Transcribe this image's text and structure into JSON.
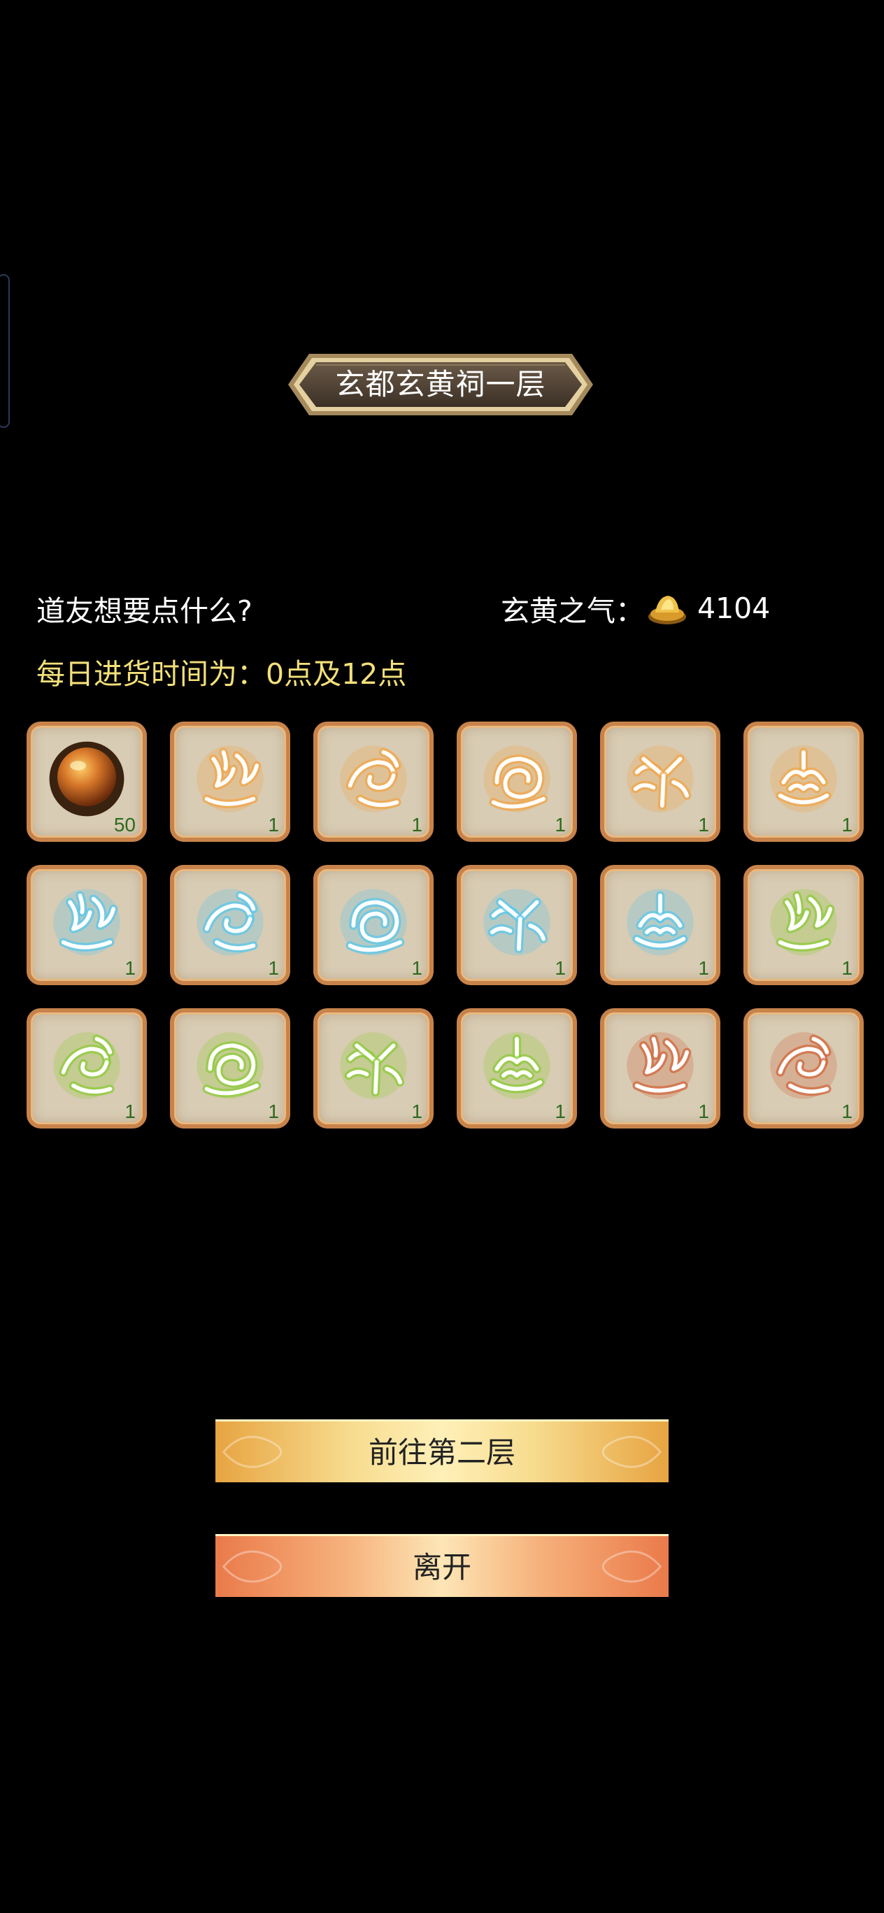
{
  "title": "玄都玄黄祠一层",
  "prompt": "道友想要点什么?",
  "currency": {
    "label": "玄黄之气：",
    "icon": "gold-ingot-icon",
    "amount": "4104"
  },
  "schedule": "每日进货时间为：0点及12点",
  "items": [
    {
      "icon": "amber-orb",
      "count": "50",
      "color": "#c9781c"
    },
    {
      "icon": "rune-flame",
      "count": "1",
      "color": "#f0a64a"
    },
    {
      "icon": "rune-swirl",
      "count": "1",
      "color": "#f0a64a"
    },
    {
      "icon": "rune-spiral",
      "count": "1",
      "color": "#f0a64a"
    },
    {
      "icon": "rune-claw",
      "count": "1",
      "color": "#f0a64a"
    },
    {
      "icon": "rune-crown",
      "count": "1",
      "color": "#f0a64a"
    },
    {
      "icon": "rune-flame",
      "count": "1",
      "color": "#5cc7ea"
    },
    {
      "icon": "rune-swirl",
      "count": "1",
      "color": "#5cc7ea"
    },
    {
      "icon": "rune-spiral",
      "count": "1",
      "color": "#5cc7ea"
    },
    {
      "icon": "rune-claw",
      "count": "1",
      "color": "#5cc7ea"
    },
    {
      "icon": "rune-crown",
      "count": "1",
      "color": "#5cc7ea"
    },
    {
      "icon": "rune-flame",
      "count": "1",
      "color": "#8fcb3b"
    },
    {
      "icon": "rune-swirl",
      "count": "1",
      "color": "#8fcb3b"
    },
    {
      "icon": "rune-spiral",
      "count": "1",
      "color": "#8fcb3b"
    },
    {
      "icon": "rune-claw",
      "count": "1",
      "color": "#8fcb3b"
    },
    {
      "icon": "rune-crown",
      "count": "1",
      "color": "#8fcb3b"
    },
    {
      "icon": "rune-flame",
      "count": "1",
      "color": "#d2683f"
    },
    {
      "icon": "rune-swirl",
      "count": "1",
      "color": "#d2683f"
    }
  ],
  "buttons": {
    "next_floor": "前往第二层",
    "leave": "离开"
  }
}
